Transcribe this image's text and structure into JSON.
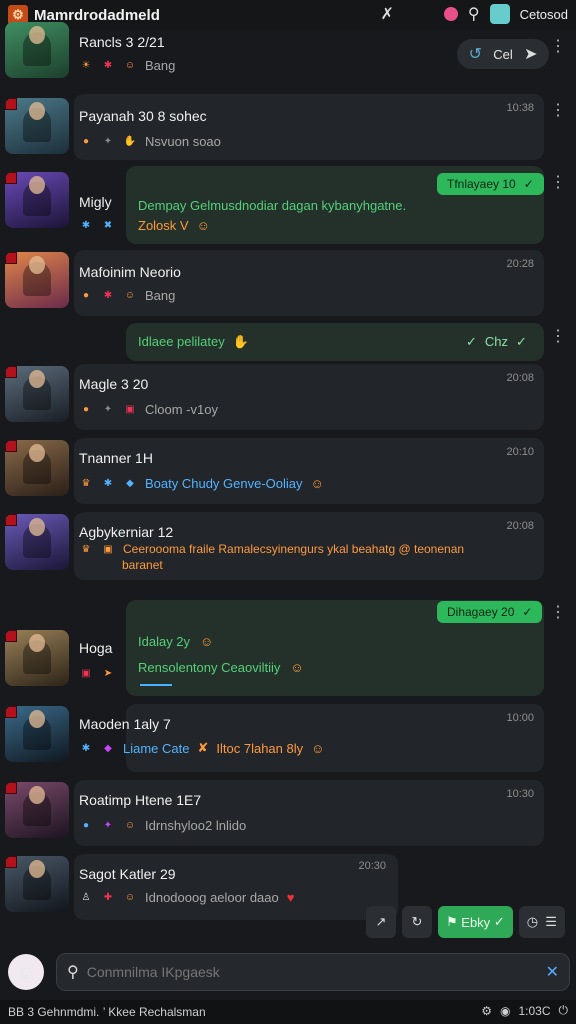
{
  "app": {
    "title": "Mamrdrodadmeld",
    "user": "Cetosod"
  },
  "top_actions": {
    "label": "Cel"
  },
  "rows": [
    {
      "name": "Rancls 3 2/21",
      "sub": "Bang",
      "time": "",
      "accent": "#2f6b3a"
    },
    {
      "name": "Payanah 30 8 sohec",
      "sub": "Nsvuon soao",
      "time": "10:38",
      "accent": "#3a5f6d"
    },
    {
      "name": "Migly",
      "sub": "",
      "time": "",
      "accent": "#4a2f7a"
    },
    {
      "name": "Mafoinim Neorio",
      "sub": "Bang",
      "time": "20:28",
      "accent": "#b55a3a"
    },
    {
      "name": "Magle 3 20",
      "sub": "Cloom -v1oy",
      "time": "20:08",
      "accent": "#2e3540"
    },
    {
      "name": "Tnanner 1H",
      "sub": "Boaty Chudy Genve-Ooliay",
      "time": "20:10",
      "accent": "#4a3a2a"
    },
    {
      "name": "Agbykerniar 12",
      "sub": "Ceeroooma fraile Ramalecsyinengurs ykal beahatg @ teonenan",
      "sub2": "baranet",
      "time": "20:08",
      "accent": "#3a3070"
    },
    {
      "name": "Hoga",
      "sub": "",
      "time": "",
      "accent": "#5a4a30"
    },
    {
      "name": "Maoden 1aly 7",
      "sub": "",
      "time": "10:00",
      "accent": "#203548"
    },
    {
      "name": "Roatimp Htene 1E7",
      "sub": "Idrnshyloo2 lnlido",
      "time": "10:30",
      "accent": "#3a2a40"
    },
    {
      "name": "Sagot Katler 29",
      "sub": "Idnodooog aeloor daao",
      "time": "20:30",
      "accent": "#2a3038"
    }
  ],
  "messages": {
    "m1": {
      "pill": "Tfnlayaey 10",
      "line1": "Dempay Gelmusdnodiar dagan kybanyhgatne.",
      "line2": "Zolosk V"
    },
    "m2": {
      "text": "Idlaee pelilatey",
      "right": "Chz"
    },
    "m3": {
      "pill": "Dihagaey 20",
      "line1": "Idalay 2y",
      "line2": "Rensolentony Ceaoviltiiy"
    },
    "m4": {
      "line1": "Liame Cate",
      "line1b": "Iltoc 7lahan 8ly"
    }
  },
  "toolbar": {
    "green_label": "Ebky"
  },
  "composer": {
    "placeholder": "Conmnilma IKpgaesk"
  },
  "statusbar": {
    "left": "BB 3 Gehnmdmi. ’ Kkee Rechalsman",
    "right": "1:03C"
  }
}
